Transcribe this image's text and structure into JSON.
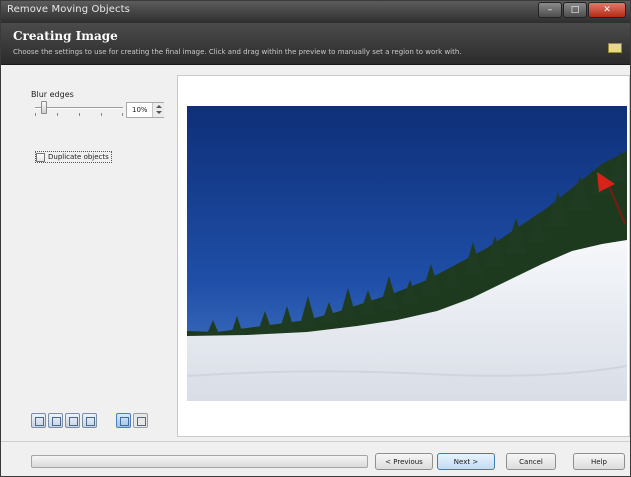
{
  "window": {
    "title": "Remove Moving Objects",
    "controls": {
      "minimize": "–",
      "maximize": "□",
      "close": "✕"
    }
  },
  "header": {
    "title": "Creating Image",
    "subtitle": "Choose the settings to use for creating the final image. Click and drag within the preview to manually set a region to work with.",
    "icon": "help-book-icon"
  },
  "settings": {
    "blur_label": "Blur edges",
    "blur_value": "10%",
    "blur_level": 0.1,
    "duplicate_label": "Duplicate objects",
    "duplicate_checked": false
  },
  "tools": [
    {
      "icon": "zoom-in-icon"
    },
    {
      "icon": "zoom-out-icon"
    },
    {
      "icon": "fit-to-window-icon"
    },
    {
      "icon": "actual-size-icon"
    },
    {
      "icon": "preview-mode-icon",
      "active": true
    },
    {
      "icon": "split-view-icon"
    }
  ],
  "footer": {
    "progress": 0,
    "previous_label": "< Previous",
    "next_label": "Next >",
    "cancel_label": "Cancel",
    "help_label": "Help"
  },
  "colors": {
    "sky": "#1f4aa0",
    "snow": "#eef1f5",
    "header_bg": "#3a3a3a"
  }
}
